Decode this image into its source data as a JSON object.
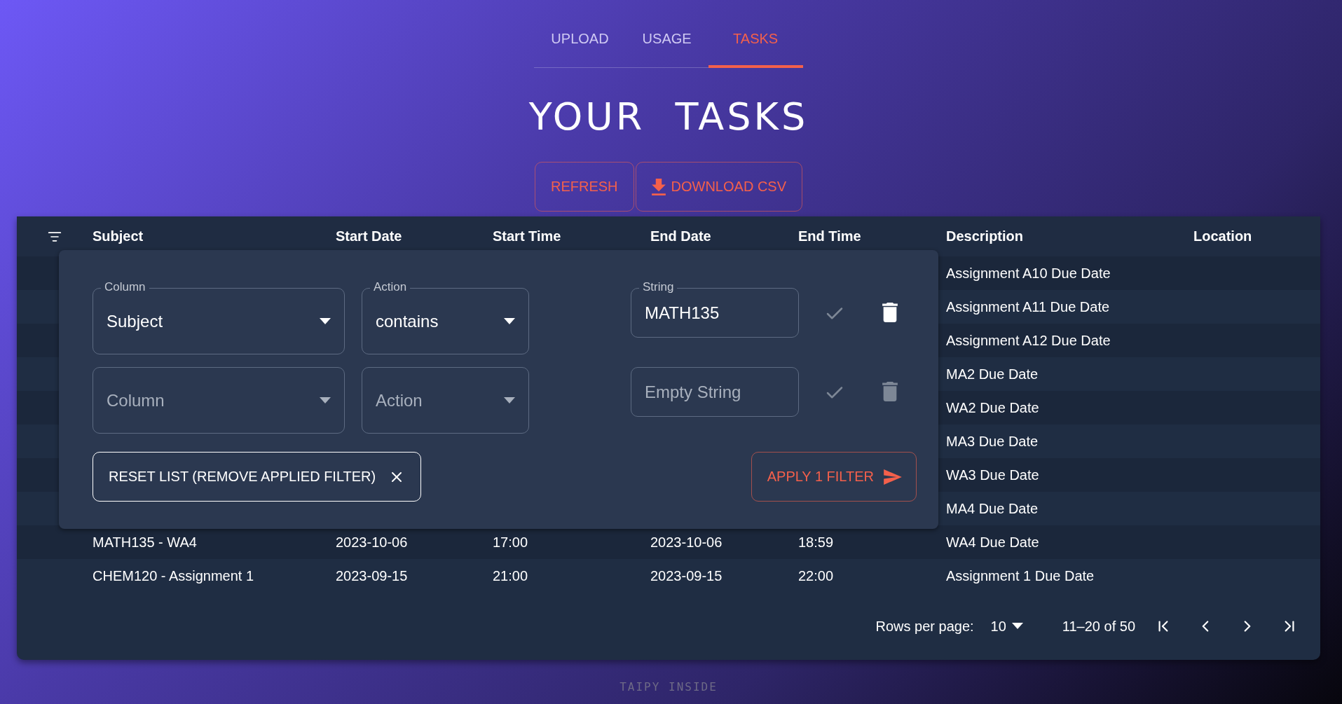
{
  "tabs": [
    {
      "label": "UPLOAD",
      "selected": false
    },
    {
      "label": "USAGE",
      "selected": false
    },
    {
      "label": "TASKS",
      "selected": true
    }
  ],
  "title": "YOUR TASKS",
  "buttons": [
    {
      "kind": "refresh",
      "label": "REFRESH"
    },
    {
      "kind": "download",
      "label": "DOWNLOAD CSV"
    }
  ],
  "table": {
    "columns": [
      "Subject",
      "Start Date",
      "Start Time",
      "End Date",
      "End Time",
      "Description",
      "Location"
    ],
    "rows": [
      {
        "description": "Assignment A10 Due Date"
      },
      {
        "description": "Assignment A11 Due Date"
      },
      {
        "description": "Assignment A12 Due Date"
      },
      {
        "description": "MA2 Due Date"
      },
      {
        "description": "WA2 Due Date"
      },
      {
        "description": "MA3 Due Date"
      },
      {
        "description": "WA3 Due Date"
      },
      {
        "description": "MA4 Due Date"
      },
      {
        "subject": "MATH135 - WA4",
        "start_date": "2023-10-06",
        "start_time": "17:00",
        "end_date": "2023-10-06",
        "end_time": "18:59",
        "description": "WA4 Due Date"
      },
      {
        "subject": "CHEM120 - Assignment 1",
        "start_date": "2023-09-15",
        "start_time": "21:00",
        "end_date": "2023-09-15",
        "end_time": "22:00",
        "description": "Assignment 1 Due Date"
      }
    ],
    "pagination": {
      "rows_per_page_label": "Rows per page:",
      "rows_per_page": "10",
      "range": "11–20 of 50"
    }
  },
  "filter_panel": {
    "filters": [
      {
        "column": {
          "label": "Column",
          "value": "Subject"
        },
        "action": {
          "label": "Action",
          "value": "contains"
        },
        "string": {
          "label": "String",
          "value": "MATH135"
        },
        "apply_enabled": false,
        "delete_enabled": true
      },
      {
        "column": {
          "placeholder": "Column"
        },
        "action": {
          "placeholder": "Action"
        },
        "string": {
          "placeholder": "Empty String"
        },
        "apply_enabled": false,
        "delete_enabled": false
      }
    ],
    "reset_label": "RESET LIST (REMOVE APPLIED FILTER)",
    "apply_label": "APPLY 1 FILTER"
  },
  "footer": "TAIPY INSIDE"
}
